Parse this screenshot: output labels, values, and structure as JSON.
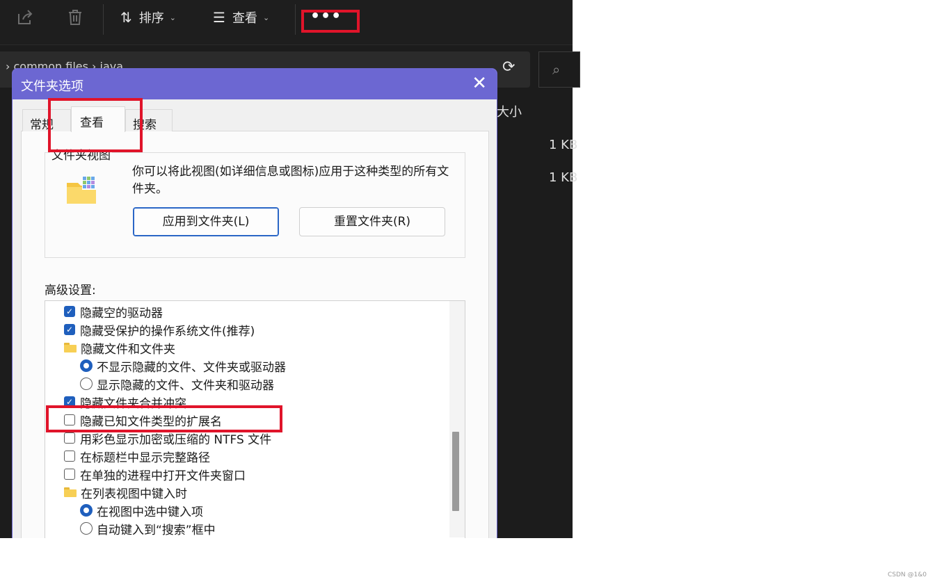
{
  "toolbar": {
    "share_icon": "share-icon",
    "delete_icon": "trash-icon",
    "sort_label": "排序",
    "view_label": "查看",
    "more_label": "•••"
  },
  "address": {
    "path_text": "› common files › java",
    "refresh_icon": "refresh-icon",
    "search_icon": "search-icon"
  },
  "file_list": {
    "size_header": "大小",
    "sizes": [
      "1 KB",
      "1 KB"
    ]
  },
  "dialog": {
    "title": "文件夹选项",
    "close_label": "✕",
    "tabs": [
      {
        "label": "常规"
      },
      {
        "label": "查看"
      },
      {
        "label": "搜索"
      }
    ],
    "folder_view": {
      "group_label": "文件夹视图",
      "description": "你可以将此视图(如详细信息或图标)应用于这种类型的所有文件夹。",
      "apply_button": "应用到文件夹(L)",
      "reset_button": "重置文件夹(R)"
    },
    "advanced_label": "高级设置:",
    "advanced_items": [
      {
        "type": "checkbox",
        "checked": true,
        "label": "隐藏空的驱动器"
      },
      {
        "type": "checkbox",
        "checked": true,
        "label": "隐藏受保护的操作系统文件(推荐)"
      },
      {
        "type": "folder",
        "label": "隐藏文件和文件夹"
      },
      {
        "type": "radio",
        "checked": true,
        "label": "不显示隐藏的文件、文件夹或驱动器"
      },
      {
        "type": "radio",
        "checked": false,
        "label": "显示隐藏的文件、文件夹和驱动器"
      },
      {
        "type": "checkbox",
        "checked": true,
        "label": "隐藏文件夹合并冲突"
      },
      {
        "type": "checkbox",
        "checked": false,
        "label": "隐藏已知文件类型的扩展名"
      },
      {
        "type": "checkbox",
        "checked": false,
        "label": "用彩色显示加密或压缩的 NTFS 文件"
      },
      {
        "type": "checkbox",
        "checked": false,
        "label": "在标题栏中显示完整路径"
      },
      {
        "type": "checkbox",
        "checked": false,
        "label": "在单独的进程中打开文件夹窗口"
      },
      {
        "type": "folder",
        "label": "在列表视图中键入时"
      },
      {
        "type": "radio",
        "checked": true,
        "label": "在视图中选中键入项"
      },
      {
        "type": "radio",
        "checked": false,
        "label": "自动键入到“搜索”框中"
      }
    ]
  },
  "highlight_color": "#e0142a",
  "accent_color": "#6c67d2",
  "watermark": "CSDN @1&0"
}
